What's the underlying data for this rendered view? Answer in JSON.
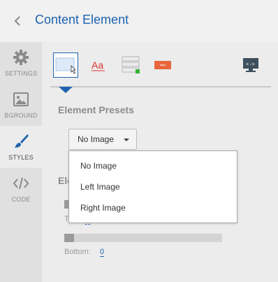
{
  "header": {
    "title": "Content Element",
    "back_icon": "chevron-left-icon"
  },
  "sidebar": {
    "items": [
      {
        "label": "SETTINGS",
        "icon": "gear-icon",
        "active": false
      },
      {
        "label": "BGROUND",
        "icon": "image-icon",
        "active": false
      },
      {
        "label": "STYLES",
        "icon": "brush-icon",
        "active": true
      },
      {
        "label": "CODE",
        "icon": "code-icon",
        "active": false
      }
    ]
  },
  "toolbar": {
    "icons": [
      "box-style-icon",
      "typography-icon",
      "form-style-icon",
      "button-style-icon",
      "code-view-icon"
    ],
    "active_index": 0
  },
  "presets": {
    "title": "Element Presets",
    "selected": "No Image",
    "options": [
      "No Image",
      "Left Image",
      "Right Image"
    ]
  },
  "element_section": {
    "title_visible": "Ele",
    "top_label_visible": "T",
    "bottom_label": "Bottom:",
    "bottom_value": "0"
  },
  "colors": {
    "accent": "#1e63b0",
    "toolbar_red": "#d9362b",
    "toolbar_orange": "#e8673d",
    "toolbar_green": "#34b233"
  }
}
